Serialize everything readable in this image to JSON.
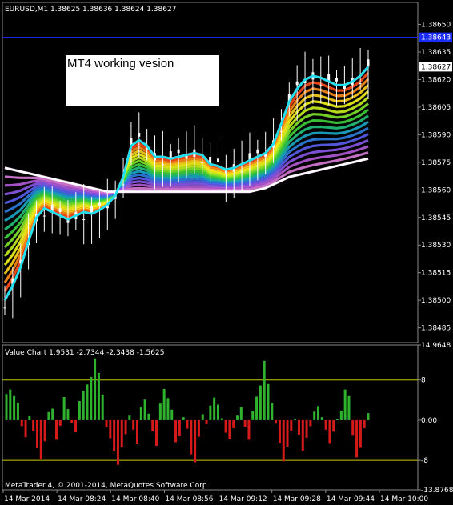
{
  "colors": {
    "background": "#000000",
    "frame": "#8a8a8a",
    "text": "#ffffff",
    "bid_line": "#1b2dff",
    "level_line": "#c8c800",
    "bull_bar": "#2fb32f",
    "bear_bar": "#d61a1a",
    "candle_up": "#ffffff",
    "candle_down": "#ffffff",
    "slow_ma": "#ffffff"
  },
  "symbol_header": "EURUSD,M1  1.38625 1.38636 1.38624 1.38627",
  "note_label": "MT4 working vesion",
  "footer": "MetaTrader 4, © 2001-2014, MetaQuotes Software Corp.",
  "chart_data": [
    {
      "type": "line",
      "title": "EURUSD,M1  1.38625 1.38636 1.38624 1.38627",
      "ylim": [
        1.38477,
        1.38662
      ],
      "y_ticks": [
        "1.38650",
        "1.38635",
        "1.38620",
        "1.38605",
        "1.38590",
        "1.38575",
        "1.38560",
        "1.38545",
        "1.38530",
        "1.38515",
        "1.38500",
        "1.38485"
      ],
      "y_tick_values": [
        1.3865,
        1.38635,
        1.3862,
        1.38605,
        1.3859,
        1.38575,
        1.3856,
        1.38545,
        1.3853,
        1.38515,
        1.385,
        1.38485
      ],
      "bid_price": 1.38643,
      "bid_label": "1.38643",
      "last_price": 1.38627,
      "last_label": "1.38627",
      "x_ticks": [
        "14 Mar 2014",
        "14 Mar 08:24",
        "14 Mar 08:40",
        "14 Mar 08:56",
        "14 Mar 09:12",
        "14 Mar 09:28",
        "14 Mar 09:44",
        "14 Mar 10:00"
      ],
      "series": [
        {
          "values": [
            1.385,
            1.38508,
            1.38518,
            1.38532,
            1.38545,
            1.3855,
            1.38548,
            1.38546,
            1.38544,
            1.38546,
            1.38548,
            1.38547,
            1.38549,
            1.38552,
            1.38557,
            1.38567,
            1.38584,
            1.38587,
            1.38584,
            1.38578,
            1.38578,
            1.38577,
            1.38578,
            1.38579,
            1.3858,
            1.38579,
            1.38574,
            1.38573,
            1.38571,
            1.38572,
            1.38574,
            1.38576,
            1.38578,
            1.3858,
            1.38585,
            1.38596,
            1.38608,
            1.38615,
            1.3862,
            1.38622,
            1.38621,
            1.38619,
            1.38617,
            1.38617,
            1.38619,
            1.38622,
            1.38627
          ]
        },
        {
          "values": [
            1.38572,
            1.38571,
            1.3857,
            1.38569,
            1.38568,
            1.38567,
            1.38566,
            1.38565,
            1.38564,
            1.38563,
            1.38562,
            1.38561,
            1.3856,
            1.38559,
            1.38559,
            1.38559,
            1.38559,
            1.38559,
            1.38559,
            1.38559,
            1.38559,
            1.38559,
            1.38559,
            1.38559,
            1.38559,
            1.38559,
            1.38559,
            1.38559,
            1.38559,
            1.38559,
            1.38559,
            1.38559,
            1.3856,
            1.38561,
            1.38563,
            1.38565,
            1.38567,
            1.38568,
            1.38569,
            1.3857,
            1.38571,
            1.38572,
            1.38573,
            1.38574,
            1.38575,
            1.38576,
            1.38577
          ]
        }
      ]
    },
    {
      "type": "bar",
      "title": "Value Chart 1.9531 -2.7344 -2.3438 -1.5625",
      "ylim": [
        -13.8768,
        14.9648
      ],
      "y_ticks": [
        "14.9648",
        "8",
        "0.00",
        "-8",
        "-13.8768"
      ],
      "y_tick_values": [
        14.9648,
        8,
        0,
        -8,
        -13.8768
      ],
      "levels": [
        8,
        -8
      ],
      "series": [
        {
          "values": [
            5.2,
            6.1,
            4.8,
            3.5,
            -1.2,
            -3.4,
            0.8,
            -2.1,
            -5.6,
            -7.8,
            -4.2,
            1.6,
            2.3,
            -3.9,
            -1.1,
            4.6,
            2.2,
            -0.5,
            -2.4,
            3.8,
            5.9,
            7.1,
            8.6,
            12.3,
            9.4,
            5.1,
            -1.4,
            -3.6,
            -6.2,
            -8.9,
            -5.4,
            -2.8,
            0.9,
            -1.9,
            -4.8,
            2.6,
            4.1,
            1.3,
            -2.2,
            -5.1,
            3.3,
            6.2,
            4.4,
            2.1,
            -4.4,
            -3.2,
            0.6,
            -1.7,
            -6.8,
            -8.4,
            -3.3,
            1.2,
            -0.8,
            2.9,
            4.5,
            3.1,
            0.4,
            -2.5,
            -3.8,
            -1.6,
            0.9,
            2.6,
            -1.3,
            -3.9,
            1.8,
            4.7,
            6.9,
            11.8,
            7.2,
            3.4,
            -0.7,
            -4.6,
            -8.2,
            -5.3,
            -2.1,
            0.3,
            -2.9,
            -6.1,
            -3.5,
            -1.2,
            1.7,
            2.8,
            0.6,
            -1.9,
            -4.7,
            -2.3,
            0.2,
            1.9,
            6.1,
            4.8,
            -3.1,
            -7.4,
            -5.5,
            -1.6,
            1.4
          ]
        }
      ]
    }
  ]
}
